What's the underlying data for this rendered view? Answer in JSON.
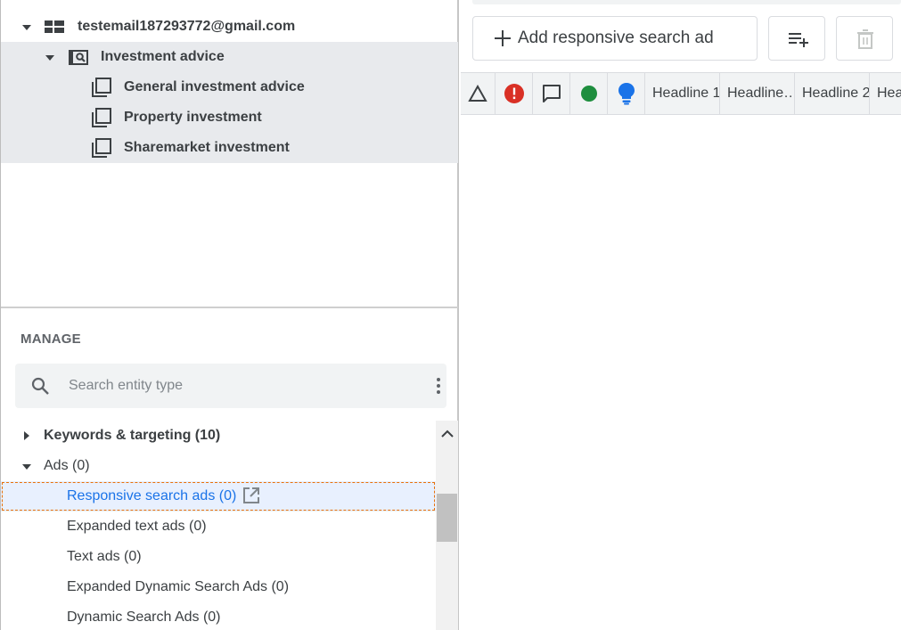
{
  "account_tree": {
    "account": {
      "email": "testemail187293772@gmail.com",
      "icon": "account-grid-icon"
    },
    "campaign": {
      "name": "Investment advice",
      "icon": "search-campaign-icon"
    },
    "ad_groups": [
      {
        "name": "General investment advice",
        "icon": "ad-group-icon"
      },
      {
        "name": "Property investment",
        "icon": "ad-group-icon"
      },
      {
        "name": "Sharemarket investment",
        "icon": "ad-group-icon"
      }
    ]
  },
  "manage": {
    "title": "MANAGE",
    "search_placeholder": "Search entity type",
    "items": [
      {
        "label": "Keywords & targeting (10)",
        "expanded": false
      },
      {
        "label": "Ads (0)",
        "expanded": true
      },
      {
        "label": "Responsive search ads (0)",
        "selected": true,
        "icon": "open-in-new-icon"
      },
      {
        "label": "Expanded text ads (0)"
      },
      {
        "label": "Text ads (0)"
      },
      {
        "label": "Expanded Dynamic Search Ads (0)"
      },
      {
        "label": "Dynamic Search Ads (0)"
      }
    ]
  },
  "toolbar": {
    "add_label": "Add responsive search ad",
    "add_list_icon": "playlist-add-icon",
    "delete_icon": "delete-icon"
  },
  "grid": {
    "icon_columns": [
      "warning-triangle-icon",
      "error-icon",
      "comment-icon",
      "status-dot-icon",
      "lightbulb-icon"
    ],
    "columns": [
      "Headline 1",
      "Headline…",
      "Headline 2",
      "Hea"
    ]
  },
  "colors": {
    "error_red": "#d93025",
    "status_green": "#1e8e3e",
    "bulb_blue": "#1a73e8",
    "selection_blue": "#1a73e8",
    "focus_outline": "#e8710a",
    "selected_row_bg": "#e8eaed"
  }
}
